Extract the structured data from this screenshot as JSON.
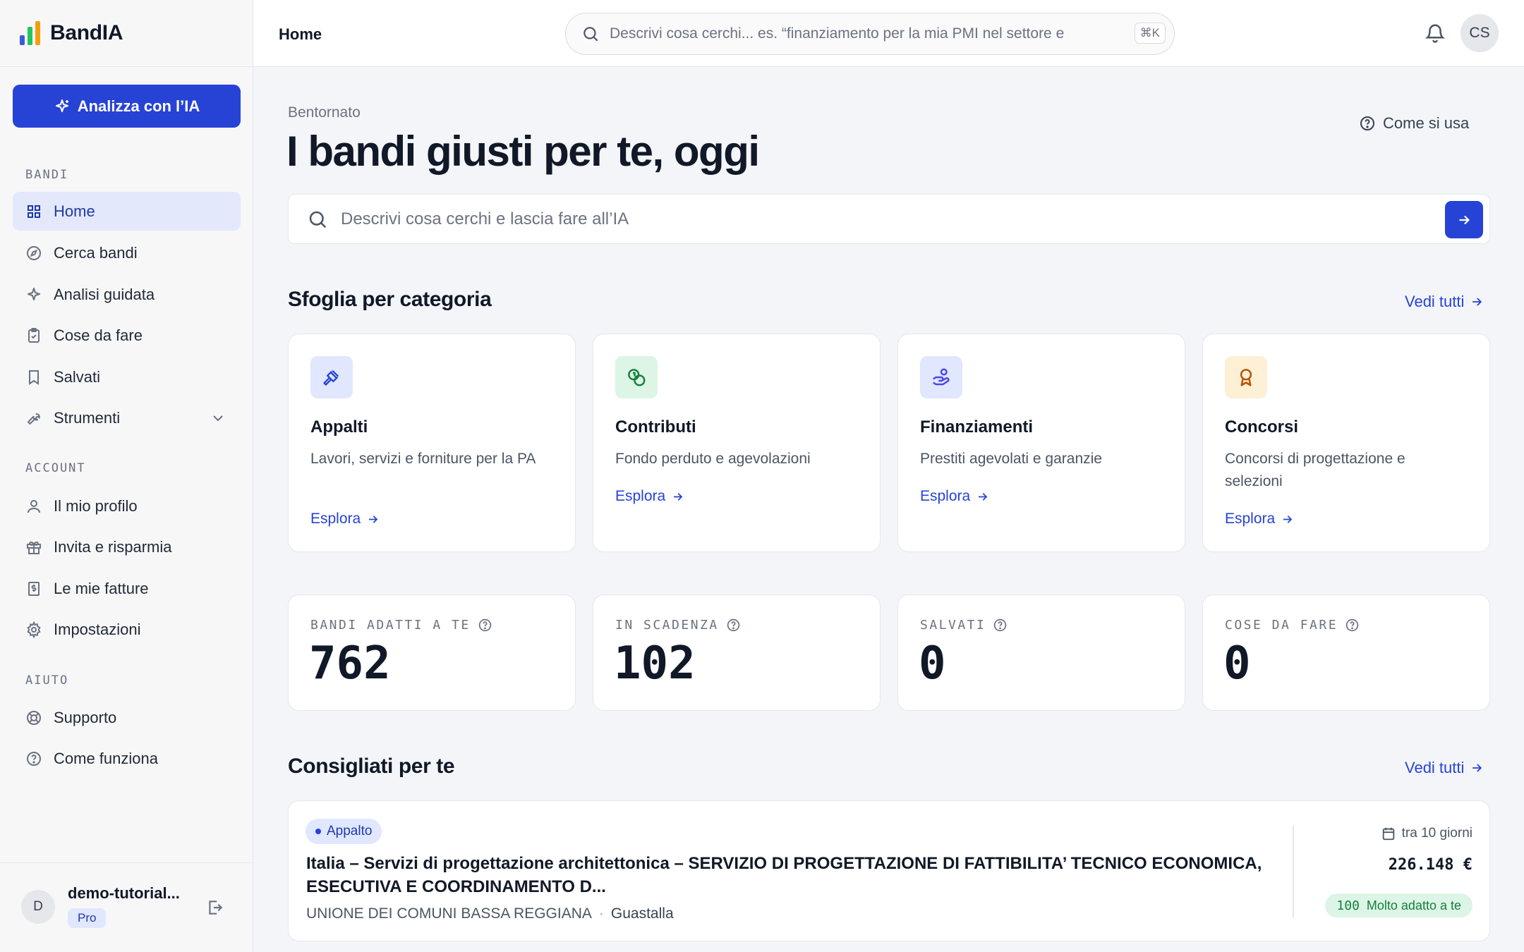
{
  "app": {
    "name": "BandIA",
    "logo_colors": [
      "#3b5bdb",
      "#22c55e",
      "#f59e0b"
    ]
  },
  "sidebar": {
    "ai_button": "Analizza con l’IA",
    "sections": [
      {
        "label": "BANDI",
        "items": [
          {
            "label": "Home",
            "icon": "grid-icon",
            "active": true
          },
          {
            "label": "Cerca bandi",
            "icon": "compass-icon"
          },
          {
            "label": "Analisi guidata",
            "icon": "sparkle-icon"
          },
          {
            "label": "Cose da fare",
            "icon": "clipboard-icon"
          },
          {
            "label": "Salvati",
            "icon": "bookmark-icon"
          },
          {
            "label": "Strumenti",
            "icon": "wrench-icon",
            "has_submenu": true
          }
        ]
      },
      {
        "label": "ACCOUNT",
        "items": [
          {
            "label": "Il mio profilo",
            "icon": "user-icon"
          },
          {
            "label": "Invita e risparmia",
            "icon": "gift-icon"
          },
          {
            "label": "Le mie fatture",
            "icon": "invoice-icon"
          },
          {
            "label": "Impostazioni",
            "icon": "gear-icon"
          }
        ]
      },
      {
        "label": "AIUTO",
        "items": [
          {
            "label": "Supporto",
            "icon": "lifebuoy-icon"
          },
          {
            "label": "Come funziona",
            "icon": "help-circle-icon"
          }
        ]
      }
    ],
    "user": {
      "initial": "D",
      "name": "demo-tutorial...",
      "plan": "Pro"
    }
  },
  "topbar": {
    "title": "Home",
    "search_placeholder": "Descrivi cosa cerchi... es. “finanziamento per la mia PMI nel settore e",
    "shortcut": "⌘K",
    "avatar": "CS"
  },
  "main": {
    "greeting": "Bentornato",
    "headline": "I bandi giusti per te, oggi",
    "help_link": "Come si usa",
    "search_placeholder": "Descrivi cosa cerchi e lascia fare all’IA",
    "categories_title": "Sfoglia per categoria",
    "see_all": "Vedi tutti",
    "categories": [
      {
        "name": "Appalti",
        "desc": "Lavori, servizi e forniture per la PA",
        "link": "Esplora",
        "icon": "gavel-icon",
        "color": "#e0e7ff",
        "icon_color": "#2643d6"
      },
      {
        "name": "Contributi",
        "desc": "Fondo perduto e agevolazioni",
        "link": "Esplora",
        "icon": "coins-icon",
        "color": "#dcf5e6",
        "icon_color": "#15803d"
      },
      {
        "name": "Finanziamenti",
        "desc": "Prestiti agevolati e garanzie",
        "link": "Esplora",
        "icon": "handcoins-icon",
        "color": "#e0e7ff",
        "icon_color": "#4f46e5"
      },
      {
        "name": "Concorsi",
        "desc": "Concorsi di progettazione e selezioni",
        "link": "Esplora",
        "icon": "award-icon",
        "color": "#fdf0d5",
        "icon_color": "#b45309"
      }
    ],
    "stats": [
      {
        "label": "BANDI ADATTI A TE",
        "value": "762"
      },
      {
        "label": "IN SCADENZA",
        "value": "102"
      },
      {
        "label": "SALVATI",
        "value": "0"
      },
      {
        "label": "COSE DA FARE",
        "value": "0"
      }
    ],
    "recommended_title": "Consigliati per te",
    "recommended": [
      {
        "tag": "Appalto",
        "title": "Italia – Servizi di progettazione architettonica – SERVIZIO DI PROGETTAZIONE DI FATTIBILITA’ TECNICO ECONOMICA, ESECUTIVA E COORDINAMENTO D...",
        "entity": "UNIONE DEI COMUNI BASSA REGGIANA",
        "location": "Guastalla",
        "deadline": "tra 10 giorni",
        "amount": "226.148 €",
        "score": "100",
        "score_label": "Molto adatto a te"
      }
    ]
  }
}
